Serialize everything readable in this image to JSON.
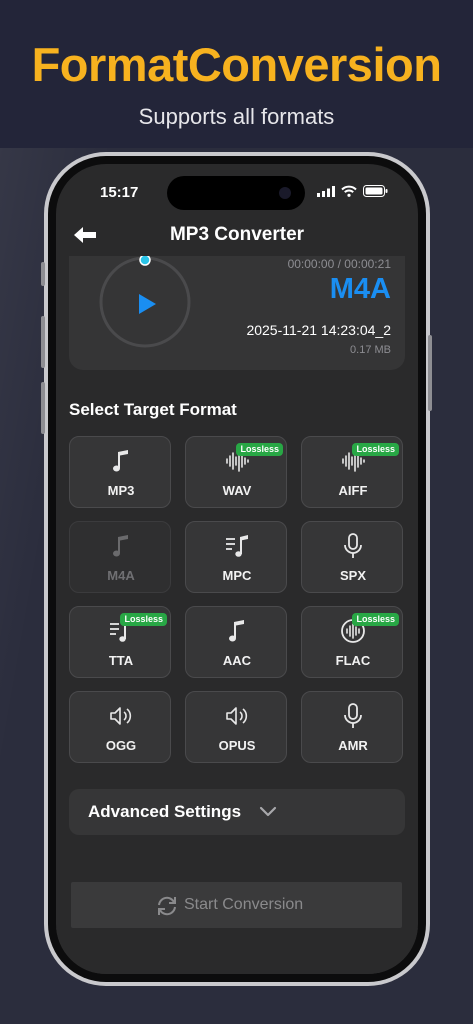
{
  "promo": {
    "title": "FormatConversion",
    "subtitle": "Supports all formats",
    "title_color": "#f7b21f"
  },
  "status_bar": {
    "time": "15:17",
    "icons": [
      "signal-icon",
      "wifi-icon",
      "battery-icon"
    ]
  },
  "header": {
    "title": "MP3 Converter",
    "back_icon": "arrow-left-icon"
  },
  "player": {
    "elapsed": "00:00:00 / 00:00:21",
    "format": "M4A",
    "filename": "2025-11-21 14:23:04_2",
    "size": "0.17 MB",
    "accent": "#1a8ef2",
    "play_icon": "play-icon",
    "progress_fraction": 0.0
  },
  "section_title": "Select Target Format",
  "badge_label": "Lossless",
  "formats": [
    {
      "label": "MP3",
      "icon": "music-note-icon",
      "lossless": false,
      "disabled": false
    },
    {
      "label": "WAV",
      "icon": "waveform-icon",
      "lossless": true,
      "disabled": false
    },
    {
      "label": "AIFF",
      "icon": "waveform-icon",
      "lossless": true,
      "disabled": false
    },
    {
      "label": "M4A",
      "icon": "music-note-icon",
      "lossless": false,
      "disabled": true
    },
    {
      "label": "MPC",
      "icon": "music-list-icon",
      "lossless": false,
      "disabled": false
    },
    {
      "label": "SPX",
      "icon": "microphone-icon",
      "lossless": false,
      "disabled": false
    },
    {
      "label": "TTA",
      "icon": "music-list-icon",
      "lossless": true,
      "disabled": false
    },
    {
      "label": "AAC",
      "icon": "music-note-icon",
      "lossless": false,
      "disabled": false
    },
    {
      "label": "FLAC",
      "icon": "waveform-circle-icon",
      "lossless": true,
      "disabled": false
    },
    {
      "label": "OGG",
      "icon": "speaker-icon",
      "lossless": false,
      "disabled": false
    },
    {
      "label": "OPUS",
      "icon": "speaker-icon",
      "lossless": false,
      "disabled": false
    },
    {
      "label": "AMR",
      "icon": "microphone-icon",
      "lossless": false,
      "disabled": false
    }
  ],
  "advanced": {
    "label": "Advanced Settings",
    "icon": "chevron-down-icon"
  },
  "start_button": {
    "label": "Start Conversion",
    "icon": "refresh-icon"
  }
}
